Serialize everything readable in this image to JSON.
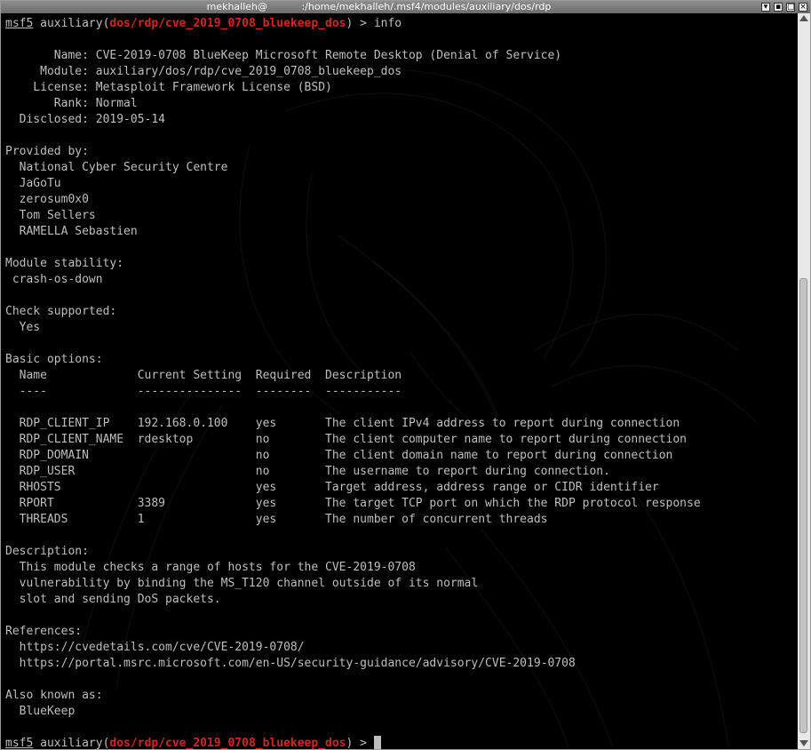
{
  "window": {
    "title": "mekhalleh@           :/home/mekhalleh/.msf4/modules/auxiliary/dos/rdp",
    "buttons": {
      "minimize": "▾",
      "sticky": "▪",
      "maximize": "□",
      "close": "×"
    }
  },
  "prompt": {
    "msf": "msf5",
    "prefix": " auxiliary(",
    "module": "dos/rdp/cve_2019_0708_bluekeep_dos",
    "suffix": ") > ",
    "command": "info"
  },
  "info": [
    "       Name: CVE-2019-0708 BlueKeep Microsoft Remote Desktop (Denial of Service)",
    "     Module: auxiliary/dos/rdp/cve_2019_0708_bluekeep_dos",
    "    License: Metasploit Framework License (BSD)",
    "       Rank: Normal",
    "  Disclosed: 2019-05-14"
  ],
  "provided_by": {
    "header": "Provided by:",
    "items": [
      "  National Cyber Security Centre",
      "  JaGoTu",
      "  zerosum0x0",
      "  Tom Sellers",
      "  RAMELLA Sebastien"
    ]
  },
  "stability": {
    "header": "Module stability:",
    "items": [
      " crash-os-down"
    ]
  },
  "check": {
    "header": "Check supported:",
    "items": [
      "  Yes"
    ]
  },
  "options": {
    "header": "Basic options:",
    "columns": "  Name             Current Setting  Required  Description",
    "rule": "  ----             ---------------  --------  -----------",
    "rows": [
      "  RDP_CLIENT_IP    192.168.0.100    yes       The client IPv4 address to report during connection",
      "  RDP_CLIENT_NAME  rdesktop         no        The client computer name to report during connection",
      "  RDP_DOMAIN                        no        The client domain name to report during connection",
      "  RDP_USER                          no        The username to report during connection.",
      "  RHOSTS                            yes       Target address, address range or CIDR identifier",
      "  RPORT            3389             yes       The target TCP port on which the RDP protocol response",
      "  THREADS          1                yes       The number of concurrent threads"
    ]
  },
  "description": {
    "header": "Description:",
    "items": [
      "  This module checks a range of hosts for the CVE-2019-0708",
      "  vulnerability by binding the MS_T120 channel outside of its normal",
      "  slot and sending DoS packets."
    ]
  },
  "references": {
    "header": "References:",
    "items": [
      "  https://cvedetails.com/cve/CVE-2019-0708/",
      "  https://portal.msrc.microsoft.com/en-US/security-guidance/advisory/CVE-2019-0708"
    ]
  },
  "aka": {
    "header": "Also known as:",
    "items": [
      "  BlueKeep"
    ]
  },
  "colors": {
    "background": "#000000",
    "text": "#bebebe",
    "prompt_red": "#d42424",
    "titlebar": "#7a7a7a",
    "scrollbar": "#e8e8e8"
  }
}
